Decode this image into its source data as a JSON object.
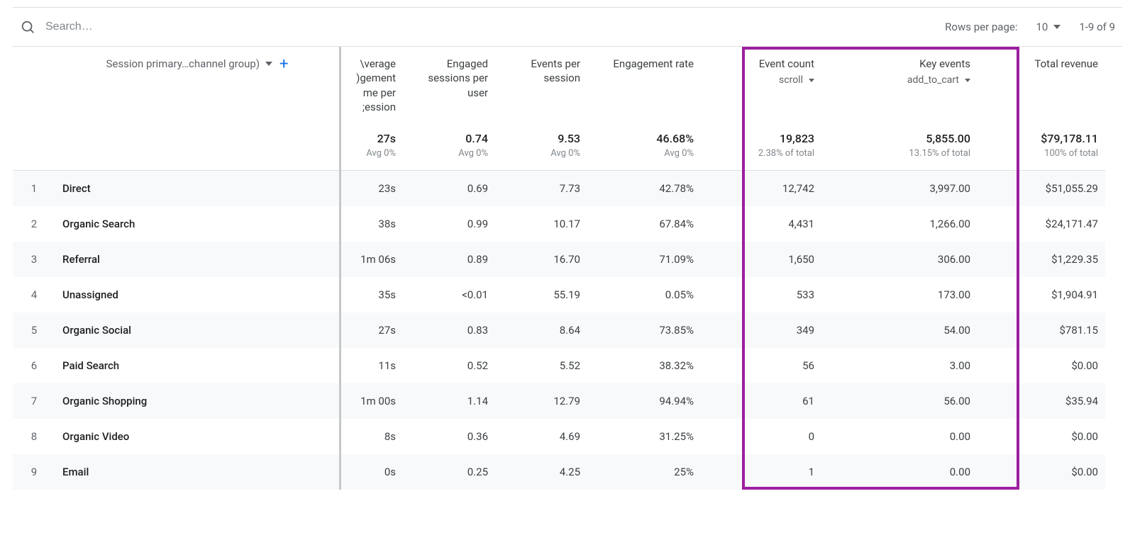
{
  "toolbar": {
    "search_placeholder": "Search…",
    "rows_per_page_label": "Rows per page:",
    "rows_per_page_value": "10",
    "range_label": "1-9 of 9"
  },
  "dimension": {
    "label": "Session primary…channel group)"
  },
  "columns": {
    "col3_header": "Average engagement time per session",
    "col3_header_clipped": "\\verage\n)gement\nme per\n;ession",
    "col4_header": "Engaged sessions per user",
    "col5_header": "Events per session",
    "col6_header": "Engagement rate",
    "col7_header": "Event count",
    "col7_sub": "scroll",
    "col8_header": "Key events",
    "col8_sub": "add_to_cart",
    "col9_header": "Total revenue"
  },
  "summary": {
    "c3": {
      "val": "27s",
      "sub": "Avg 0%"
    },
    "c4": {
      "val": "0.74",
      "sub": "Avg 0%"
    },
    "c5": {
      "val": "9.53",
      "sub": "Avg 0%"
    },
    "c6": {
      "val": "46.68%",
      "sub": "Avg 0%"
    },
    "c7": {
      "val": "19,823",
      "sub": "2.38% of total"
    },
    "c8": {
      "val": "5,855.00",
      "sub": "13.15% of total"
    },
    "c9": {
      "val": "$79,178.11",
      "sub": "100% of total"
    }
  },
  "rows": [
    {
      "n": "1",
      "name": "Direct",
      "c3": "23s",
      "c4": "0.69",
      "c5": "7.73",
      "c6": "42.78%",
      "c7": "12,742",
      "c8": "3,997.00",
      "c9": "$51,055.29"
    },
    {
      "n": "2",
      "name": "Organic Search",
      "c3": "38s",
      "c4": "0.99",
      "c5": "10.17",
      "c6": "67.84%",
      "c7": "4,431",
      "c8": "1,266.00",
      "c9": "$24,171.47"
    },
    {
      "n": "3",
      "name": "Referral",
      "c3": "1m 06s",
      "c4": "0.89",
      "c5": "16.70",
      "c6": "71.09%",
      "c7": "1,650",
      "c8": "306.00",
      "c9": "$1,229.35"
    },
    {
      "n": "4",
      "name": "Unassigned",
      "c3": "35s",
      "c4": "<0.01",
      "c5": "55.19",
      "c6": "0.05%",
      "c7": "533",
      "c8": "173.00",
      "c9": "$1,904.91"
    },
    {
      "n": "5",
      "name": "Organic Social",
      "c3": "27s",
      "c4": "0.83",
      "c5": "8.64",
      "c6": "73.85%",
      "c7": "349",
      "c8": "54.00",
      "c9": "$781.15"
    },
    {
      "n": "6",
      "name": "Paid Search",
      "c3": "11s",
      "c4": "0.52",
      "c5": "5.52",
      "c6": "38.32%",
      "c7": "56",
      "c8": "3.00",
      "c9": "$0.00"
    },
    {
      "n": "7",
      "name": "Organic Shopping",
      "c3": "1m 00s",
      "c4": "1.14",
      "c5": "12.79",
      "c6": "94.94%",
      "c7": "61",
      "c8": "56.00",
      "c9": "$35.94"
    },
    {
      "n": "8",
      "name": "Organic Video",
      "c3": "8s",
      "c4": "0.36",
      "c5": "4.69",
      "c6": "31.25%",
      "c7": "0",
      "c8": "0.00",
      "c9": "$0.00"
    },
    {
      "n": "9",
      "name": "Email",
      "c3": "0s",
      "c4": "0.25",
      "c5": "4.25",
      "c6": "25%",
      "c7": "1",
      "c8": "0.00",
      "c9": "$0.00"
    }
  ]
}
